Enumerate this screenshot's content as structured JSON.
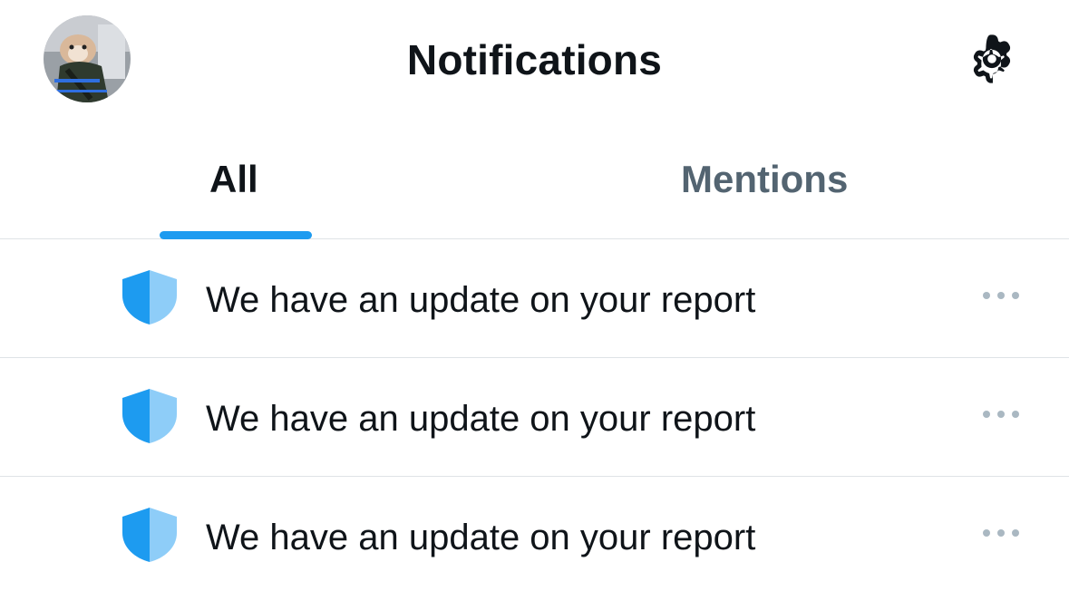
{
  "header": {
    "title": "Notifications",
    "avatar_icon": "profile-avatar",
    "settings_icon": "gear-icon"
  },
  "tabs": [
    {
      "label": "All",
      "active": true
    },
    {
      "label": "Mentions",
      "active": false
    }
  ],
  "notifications": [
    {
      "icon": "shield-icon",
      "text": "We have an update on your report",
      "more_icon": "more-icon"
    },
    {
      "icon": "shield-icon",
      "text": "We have an update on your report",
      "more_icon": "more-icon"
    },
    {
      "icon": "shield-icon",
      "text": "We have an update on your report",
      "more_icon": "more-icon"
    }
  ],
  "colors": {
    "accent": "#1d9bf0",
    "shield_dark": "#1d9bf0",
    "shield_light": "#8ecdf8",
    "text_primary": "#0f1419",
    "text_secondary": "#536471",
    "divider": "#dfe3e6",
    "more_dots": "#aab8c2"
  }
}
